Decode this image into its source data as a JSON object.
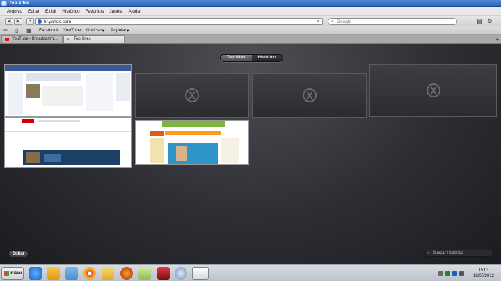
{
  "window": {
    "title": "Top Sites"
  },
  "menu": [
    "Arquivo",
    "Editar",
    "Exibir",
    "Histórico",
    "Favoritos",
    "Janela",
    "Ajuda"
  ],
  "toolbar": {
    "url": "br.yahoo.com",
    "search_placeholder": "Google"
  },
  "bookmarks": [
    "Facebook",
    "YouTube",
    "Notícias",
    "Popular"
  ],
  "tabs": [
    {
      "label": "YouTube - Broadcast Y...",
      "active": false
    },
    {
      "label": "Top Sites",
      "active": true
    }
  ],
  "topsites": {
    "segments": [
      "Top Sites",
      "Histórico"
    ],
    "active_segment": "Top Sites",
    "edit_label": "Editar",
    "search_placeholder": "Buscar Histórico"
  },
  "taskbar": {
    "start_label": "Iniciar",
    "time": "15:03",
    "date": "18/05/2012"
  },
  "colors": {
    "titlebar": "#3a72c9",
    "content_bg": "#2d2e33"
  }
}
